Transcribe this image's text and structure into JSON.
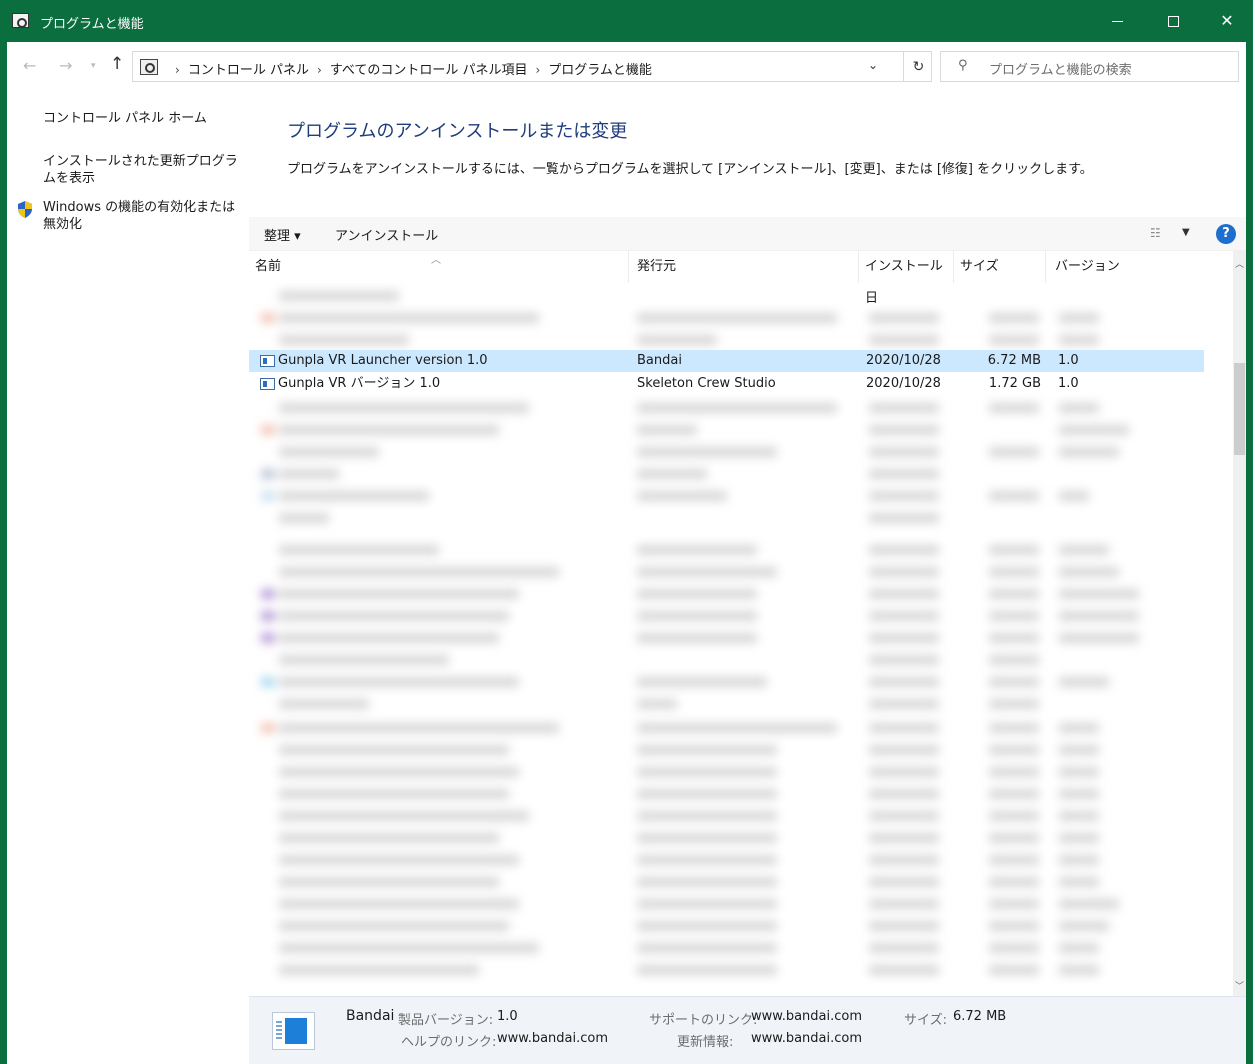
{
  "window": {
    "title": "プログラムと機能",
    "colors": {
      "titlebar": "#0a6e3f",
      "selection": "#cce8ff",
      "heading": "#1f3d7a"
    }
  },
  "address": {
    "crumbs": [
      "コントロール パネル",
      "すべてのコントロール パネル項目",
      "プログラムと機能"
    ],
    "search_placeholder": "プログラムと機能の検索"
  },
  "sidebar": {
    "home": "コントロール パネル ホーム",
    "updates": "インストールされた更新プログラムを表示",
    "features": "Windows の機能の有効化または無効化"
  },
  "main": {
    "title": "プログラムのアンインストールまたは変更",
    "description": "プログラムをアンインストールするには、一覧からプログラムを選択して [アンインストール]、[変更]、または [修復] をクリックします。"
  },
  "toolbar": {
    "organize": "整理 ▾",
    "uninstall": "アンインストール"
  },
  "columns": {
    "name": "名前",
    "publisher": "発行元",
    "install_date": "インストール日",
    "size": "サイズ",
    "version": "バージョン"
  },
  "programs": [
    {
      "name": "Gunpla VR Launcher version 1.0",
      "publisher": "Bandai",
      "date": "2020/10/28",
      "size": "6.72 MB",
      "version": "1.0",
      "selected": true
    },
    {
      "name": "Gunpla VR バージョン 1.0",
      "publisher": "Skeleton Crew Studio",
      "date": "2020/10/28",
      "size": "1.72 GB",
      "version": "1.0",
      "selected": false
    }
  ],
  "details": {
    "publisher": "Bandai",
    "product_version_label": "製品バージョン:",
    "product_version": "1.0",
    "help_link_label": "ヘルプのリンク:",
    "help_link": "www.bandai.com",
    "support_link_label": "サポートのリンク:",
    "support_link": "www.bandai.com",
    "update_info_label": "更新情報:",
    "update_info": "www.bandai.com",
    "size_label": "サイズ:",
    "size": "6.72 MB"
  }
}
